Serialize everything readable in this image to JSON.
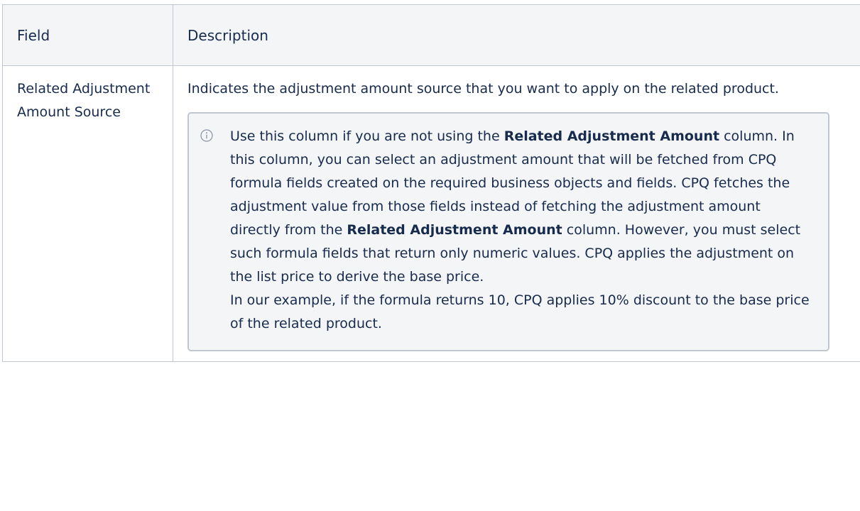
{
  "table": {
    "headers": {
      "field": "Field",
      "description": "Description"
    },
    "row": {
      "field_name": "Related Adjustment Amount Source",
      "description": "Indicates the adjustment amount source that you want to apply on the related product.",
      "note": {
        "icon": "info-icon",
        "segments": [
          {
            "text": "Use this column if you are not using the ",
            "bold": false
          },
          {
            "text": "Related Adjustment Amount",
            "bold": true
          },
          {
            "text": " column. In this column, you can select an adjustment amount that will be fetched from CPQ formula fields created on the required business objects and fields. CPQ fetches the adjustment value from those fields instead of fetching the adjustment amount directly from the ",
            "bold": false
          },
          {
            "text": "Related Adjustment Amount",
            "bold": true
          },
          {
            "text": " column. However, you must select such formula fields that return only numeric values. CPQ applies the adjustment on the list price to derive the base price.",
            "bold": false
          }
        ],
        "example": "In our example, if the formula returns 10, CPQ applies 10% discount to the base price of the related product."
      }
    }
  }
}
